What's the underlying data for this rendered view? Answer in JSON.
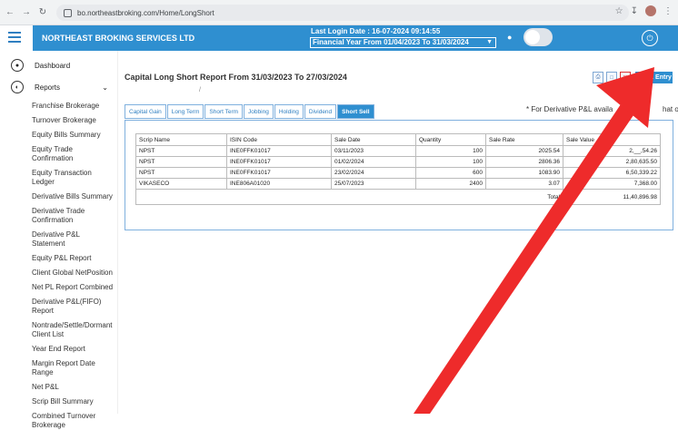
{
  "browser": {
    "url": "bo.northeastbroking.com/Home/LongShort"
  },
  "header": {
    "brand": "NORTHEAST BROKING SERVICES LTD",
    "last_login": "Last Login Date : 16-07-2024 09:14:55",
    "financial_year": "Financial Year From 01/04/2023 To 31/03/2024"
  },
  "sidebar": {
    "dashboard": "Dashboard",
    "reports": "Reports",
    "items": [
      "Franchise Brokerage",
      "Turnover Brokerage",
      "Equity Bills Summary",
      "Equity Trade Confirmation",
      "Equity Transaction Ledger",
      "Derivative Bills Summary",
      "Derivative Trade Confirmation",
      "Derivative P&L Statement",
      "Equity P&L Report",
      "Client Global NetPosition",
      "Net PL Report Combined",
      "Derivative P&L(FIFO) Report",
      "Nontrade/Settle/Dormant Client List",
      "Year End Report",
      "Margin Report Date Range",
      "Net P&L",
      "Scrip Bill Summary",
      "Combined Turnover Brokerage"
    ]
  },
  "report": {
    "title": "Capital Long Short Report From 31/03/2023 To 27/03/2024",
    "stock_entry": "Stock Entry",
    "note_left": "* For Derivative P&L availa",
    "note_right": "hat only",
    "tabs": [
      "Capital Gain",
      "Long Term",
      "Short Term",
      "Jobbing",
      "Holding",
      "Dividend",
      "Short Sell"
    ],
    "active_tab": "Short Sell",
    "columns": [
      "Scrip Name",
      "ISIN Code",
      "Sale Date",
      "Quantity",
      "Sale Rate",
      "Sale Value"
    ],
    "rows": [
      [
        "NPST",
        "INE0FFK01017",
        "03/11/2023",
        "100",
        "2025.54",
        "2,__,54.26"
      ],
      [
        "NPST",
        "INE0FFK01017",
        "01/02/2024",
        "100",
        "2806.36",
        "2,80,635.50"
      ],
      [
        "NPST",
        "INE0FFK01017",
        "23/02/2024",
        "600",
        "1083.90",
        "6,50,339.22"
      ],
      [
        "VIKASECO",
        "INE806A01020",
        "25/07/2023",
        "2400",
        "3.07",
        "7,368.00"
      ]
    ],
    "total_label": "Total",
    "total_value": "11,40,896.98"
  },
  "colors": {
    "brand_blue": "#2f8fd0",
    "annotation_red": "#ee2b2b"
  }
}
